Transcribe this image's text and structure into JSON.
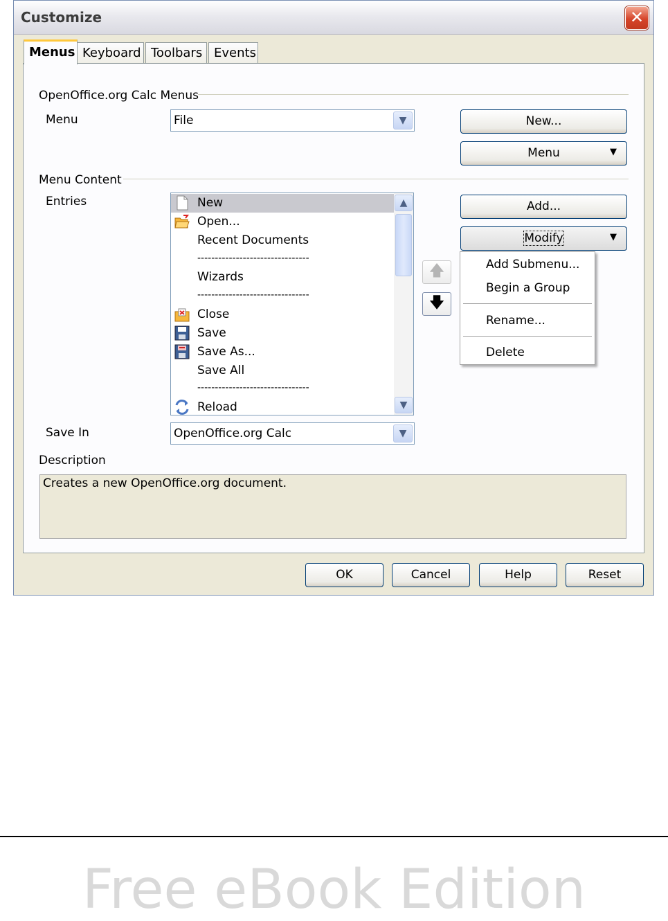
{
  "window": {
    "title": "Customize",
    "close_label": "✕"
  },
  "tabs": [
    {
      "label": "Menus"
    },
    {
      "label": "Keyboard"
    },
    {
      "label": "Toolbars"
    },
    {
      "label": "Events"
    }
  ],
  "menus_group": {
    "header": "OpenOffice.org Calc Menus",
    "menu_label": "Menu",
    "menu_value": "File",
    "new_button": "New...",
    "menu_button": "Menu"
  },
  "content_group": {
    "header": "Menu Content",
    "entries_label": "Entries",
    "entries": [
      {
        "label": "New",
        "icon": "new-document-icon"
      },
      {
        "label": "Open...",
        "icon": "open-folder-icon"
      },
      {
        "label": "Recent Documents",
        "icon": ""
      },
      {
        "label": "Wizards",
        "icon": ""
      },
      {
        "label": "Close",
        "icon": "close-document-icon"
      },
      {
        "label": "Save",
        "icon": "save-icon"
      },
      {
        "label": "Save As...",
        "icon": "save-as-icon"
      },
      {
        "label": "Save All",
        "icon": ""
      },
      {
        "label": "Reload",
        "icon": "reload-icon"
      }
    ],
    "separator": "--------------------------------",
    "add_button": "Add...",
    "modify_button": "Modify",
    "save_in_label": "Save In",
    "save_in_value": "OpenOffice.org Calc",
    "description_label": "Description",
    "description_text": "Creates a new OpenOffice.org document."
  },
  "modify_menu": {
    "items": [
      "Add Submenu...",
      "Begin a Group",
      "Rename...",
      "Delete"
    ]
  },
  "footer_buttons": {
    "ok": "OK",
    "cancel": "Cancel",
    "help": "Help",
    "reset": "Reset"
  },
  "page_footer": "Free eBook Edition"
}
